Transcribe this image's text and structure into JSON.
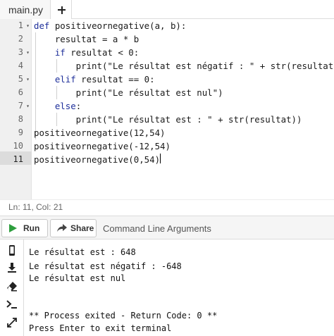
{
  "tabs": {
    "file": "main.py",
    "add": "+"
  },
  "editor": {
    "line_numbers": [
      "1",
      "2",
      "3",
      "4",
      "5",
      "6",
      "7",
      "8",
      "9",
      "10",
      "11"
    ],
    "fold_markers": [
      "▾",
      "",
      "▾",
      "",
      "▾",
      "",
      "▾",
      "",
      "",
      "",
      ""
    ],
    "lines": [
      "def positiveornegative(a, b):",
      "    resultat = a * b",
      "    if resultat < 0:",
      "        print(\"Le résultat est négatif : \" + str(resultat))",
      "    elif resultat == 0:",
      "        print(\"Le résultat est nul\")",
      "    else:",
      "        print(\"Le résultat est : \" + str(resultat))",
      "positiveornegative(12,54)",
      "positiveornegative(-12,54)",
      "positiveornegative(0,54)"
    ],
    "status": "Ln: 11,  Col: 21"
  },
  "toolbar": {
    "run_label": "Run",
    "share_label": "Share",
    "args_placeholder": "Command Line Arguments"
  },
  "console": {
    "icons": [
      "mobile-icon",
      "download-icon",
      "eraser-icon",
      "terminal-icon",
      "expand-icon"
    ],
    "lines": [
      "Le résultat est : 648",
      "Le résultat est négatif : -648",
      "Le résultat est nul",
      "",
      "",
      "** Process exited - Return Code: 0 **",
      "Press Enter to exit terminal"
    ]
  },
  "colors": {
    "run_green": "#2e9e3e",
    "keyword_blue": "#1e2f9a"
  }
}
